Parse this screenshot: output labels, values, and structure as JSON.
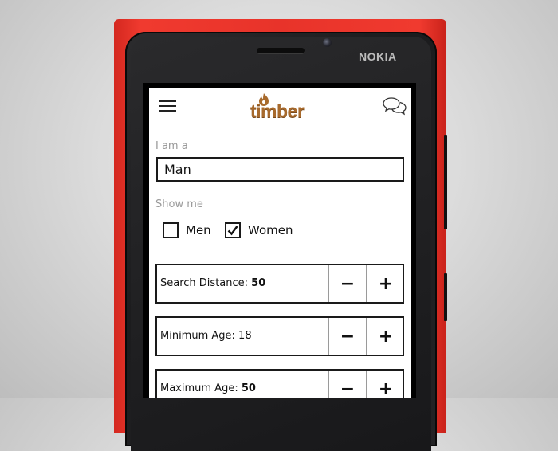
{
  "device": {
    "brand": "NOKIA",
    "shell_color": "#e8332a"
  },
  "app": {
    "title": "timber",
    "brand_color": "#a86a2c",
    "icons": {
      "menu": "hamburger-menu-icon",
      "logo_mark": "flame-icon",
      "chat": "chat-bubbles-icon"
    }
  },
  "form": {
    "gender_label": "I am a",
    "gender_value": "Man",
    "show_me_label": "Show me",
    "show_me_options": [
      {
        "label": "Men",
        "checked": false
      },
      {
        "label": "Women",
        "checked": true
      }
    ],
    "steppers": [
      {
        "label": "Search Distance:",
        "value": "50",
        "minus": "−",
        "plus": "+"
      },
      {
        "label": "Minimum Age:",
        "value": "18",
        "minus": "−",
        "plus": "+"
      },
      {
        "label": "Maximum Age:",
        "value": "50",
        "minus": "−",
        "plus": "+"
      }
    ]
  }
}
